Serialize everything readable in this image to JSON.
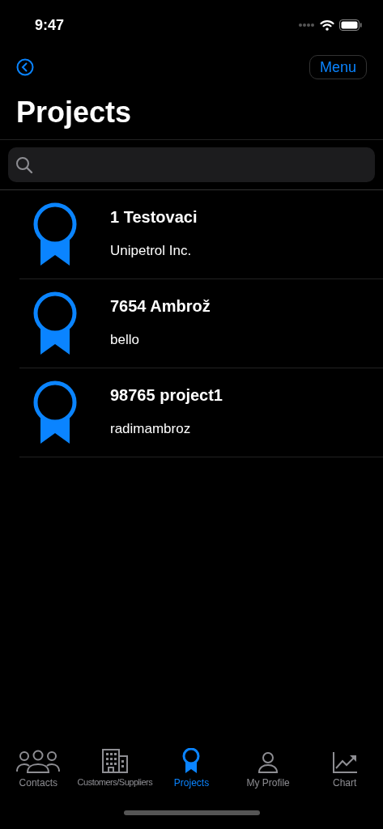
{
  "status_bar": {
    "time": "9:47"
  },
  "nav": {
    "menu_button": "Menu"
  },
  "title": "Projects",
  "projects": [
    {
      "title": "1 Testovaci",
      "subtitle": "Unipetrol Inc."
    },
    {
      "title": "7654 Ambrož",
      "subtitle": "bello"
    },
    {
      "title": "98765 project1",
      "subtitle": "radimambroz"
    }
  ],
  "tabs": [
    {
      "label": "Contacts",
      "kind": "people",
      "selected": false
    },
    {
      "label": "Customers/Suppliers",
      "kind": "building",
      "selected": false
    },
    {
      "label": "Projects",
      "kind": "ribbon",
      "selected": true
    },
    {
      "label": "My Profile",
      "kind": "person",
      "selected": false
    },
    {
      "label": "Chart",
      "kind": "chart",
      "selected": false
    }
  ]
}
